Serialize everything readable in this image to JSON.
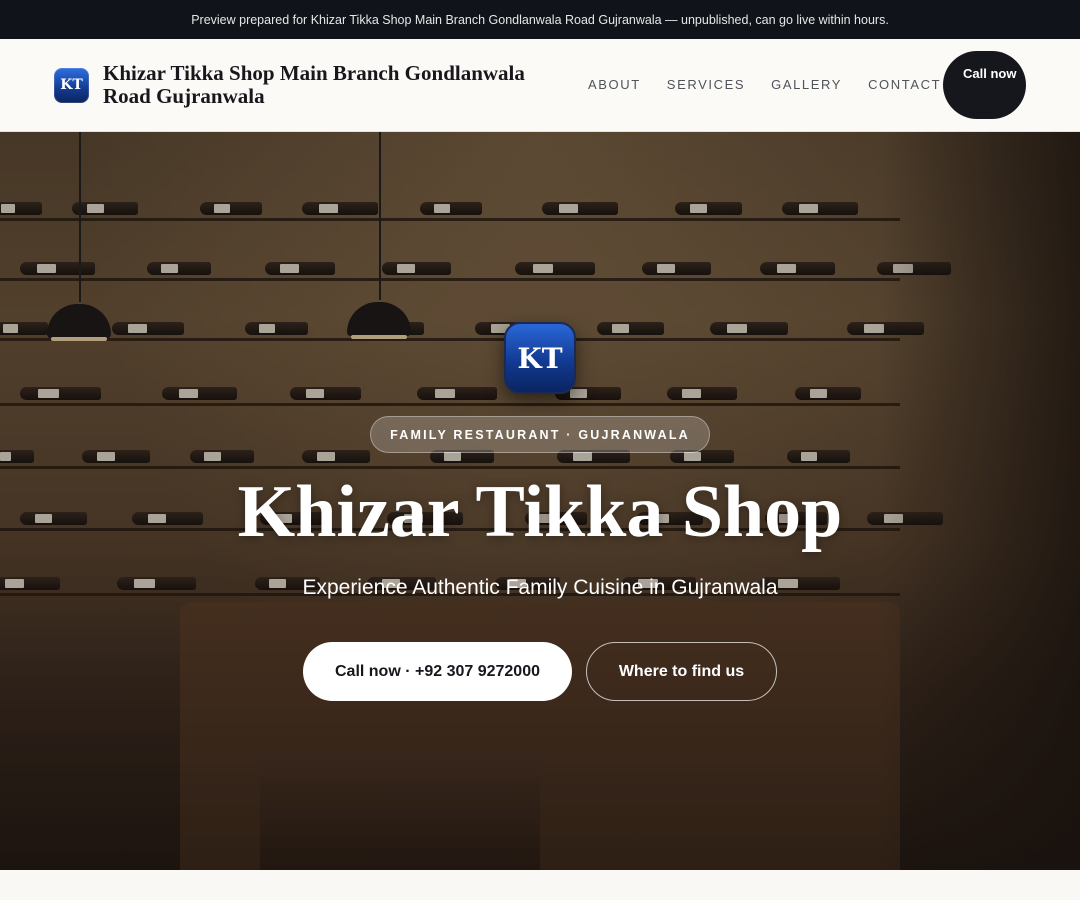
{
  "topbar": {
    "text": "Preview prepared for Khizar Tikka Shop Main Branch Gondlanwala Road Gujranwala — unpublished, can go live within hours."
  },
  "header": {
    "logo_text": "KT",
    "brand_name": "Khizar Tikka Shop Main Branch Gondlanwala Road Gujranwala",
    "nav": [
      "ABOUT",
      "SERVICES",
      "GALLERY",
      "CONTACT"
    ],
    "call_button": "Call now"
  },
  "hero": {
    "logo_text": "KT",
    "tag": "FAMILY RESTAURANT · GUJRANWALA",
    "title": "Khizar Tikka Shop",
    "subtitle": "Experience Authentic Family Cuisine in Gujranwala",
    "primary_button": "Call now · +92 307 9272000",
    "secondary_button": "Where to find us"
  },
  "colors": {
    "topbar_bg": "#101319",
    "dark_button": "#16171d",
    "logo_blue": "#133a8f"
  }
}
